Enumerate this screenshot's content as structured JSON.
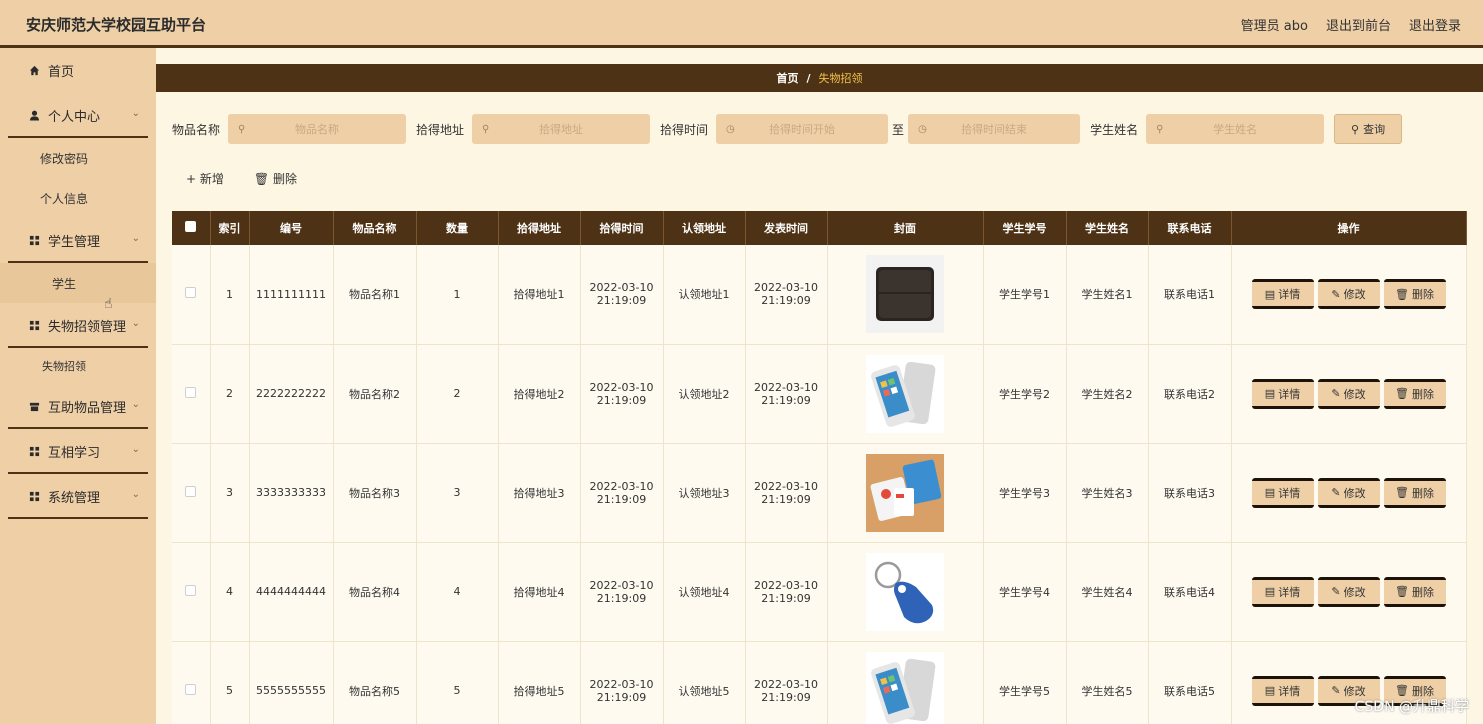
{
  "header": {
    "title": "安庆师范大学校园互助平台",
    "admin_label": "管理员 abo",
    "to_front_label": "退出到前台",
    "logout_label": "退出登录"
  },
  "sidebar": {
    "home": "首页",
    "personal_center": "个人中心",
    "change_password": "修改密码",
    "personal_info": "个人信息",
    "student_mgmt": "学生管理",
    "student": "学生",
    "lost_found_mgmt": "失物招领管理",
    "lost_found": "失物招领",
    "mutual_items_mgmt": "互助物品管理",
    "mutual_learning": "互相学习",
    "system_mgmt": "系统管理"
  },
  "breadcrumb": {
    "home": "首页",
    "sep": "/",
    "current": "失物招领"
  },
  "search": {
    "item_name_label": "物品名称",
    "item_name_placeholder": "物品名称",
    "address_label": "拾得地址",
    "address_placeholder": "拾得地址",
    "time_label": "拾得时间",
    "time_start_placeholder": "拾得时间开始",
    "to_label": "至",
    "time_end_placeholder": "拾得时间结束",
    "student_name_label": "学生姓名",
    "student_name_placeholder": "学生姓名",
    "query_label": "查询"
  },
  "actions": {
    "add_label": "新增",
    "delete_label": "删除"
  },
  "table": {
    "headers": [
      "索引",
      "编号",
      "物品名称",
      "数量",
      "拾得地址",
      "拾得时间",
      "认领地址",
      "发表时间",
      "封面",
      "学生学号",
      "学生姓名",
      "联系电话",
      "操作"
    ],
    "detail_label": "详情",
    "edit_label": "修改",
    "delete_label": "删除",
    "rows": [
      {
        "idx": "1",
        "code": "1111111111",
        "name": "物品名称1",
        "qty": "1",
        "address": "拾得地址1",
        "found_date": "2022-03-10",
        "found_time": "21:19:09",
        "claim": "认领地址1",
        "pub_date": "2022-03-10",
        "pub_time": "21:19:09",
        "cover": "wallet",
        "sid": "学生学号1",
        "sname": "学生姓名1",
        "phone": "联系电话1"
      },
      {
        "idx": "2",
        "code": "2222222222",
        "name": "物品名称2",
        "qty": "2",
        "address": "拾得地址2",
        "found_date": "2022-03-10",
        "found_time": "21:19:09",
        "claim": "认领地址2",
        "pub_date": "2022-03-10",
        "pub_time": "21:19:09",
        "cover": "phone",
        "sid": "学生学号2",
        "sname": "学生姓名2",
        "phone": "联系电话2"
      },
      {
        "idx": "3",
        "code": "3333333333",
        "name": "物品名称3",
        "qty": "3",
        "address": "拾得地址3",
        "found_date": "2022-03-10",
        "found_time": "21:19:09",
        "claim": "认领地址3",
        "pub_date": "2022-03-10",
        "pub_time": "21:19:09",
        "cover": "cards",
        "sid": "学生学号3",
        "sname": "学生姓名3",
        "phone": "联系电话3"
      },
      {
        "idx": "4",
        "code": "4444444444",
        "name": "物品名称4",
        "qty": "4",
        "address": "拾得地址4",
        "found_date": "2022-03-10",
        "found_time": "21:19:09",
        "claim": "认领地址4",
        "pub_date": "2022-03-10",
        "pub_time": "21:19:09",
        "cover": "keyfob",
        "sid": "学生学号4",
        "sname": "学生姓名4",
        "phone": "联系电话4"
      },
      {
        "idx": "5",
        "code": "5555555555",
        "name": "物品名称5",
        "qty": "5",
        "address": "拾得地址5",
        "found_date": "2022-03-10",
        "found_time": "21:19:09",
        "claim": "认领地址5",
        "pub_date": "2022-03-10",
        "pub_time": "21:19:09",
        "cover": "phone",
        "sid": "学生学号5",
        "sname": "学生姓名5",
        "phone": "联系电话5"
      }
    ]
  },
  "watermark": "CSDN @升鼎科学",
  "colors": {
    "header_bg": "#eecfa6",
    "dark_brown": "#4e3215",
    "page_bg": "#fdf6e3",
    "accent_yellow": "#f0c14b"
  }
}
